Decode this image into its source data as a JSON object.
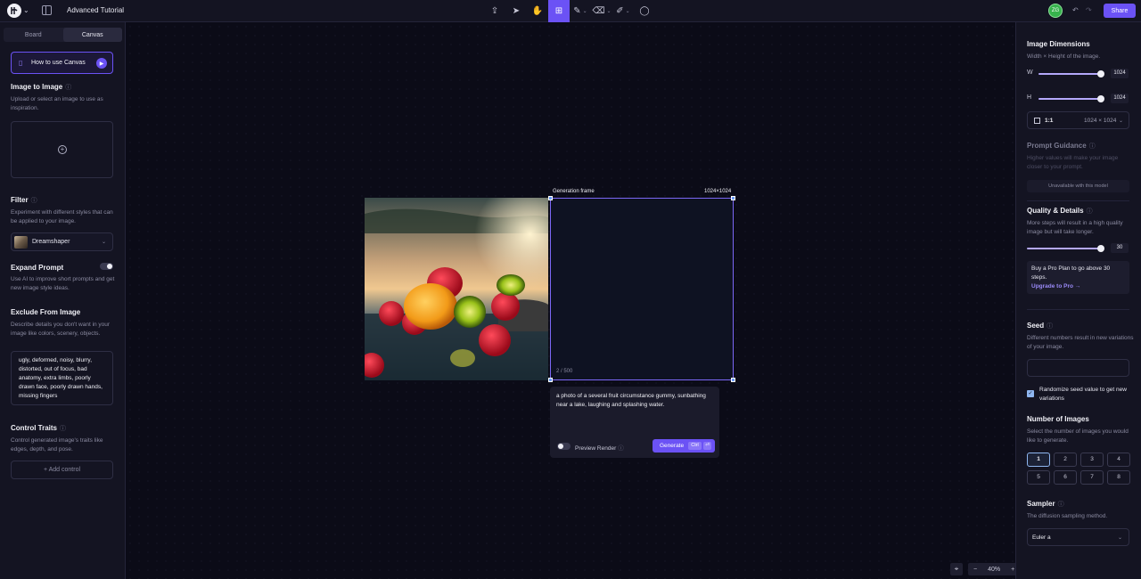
{
  "header": {
    "project_title": "Advanced Tutorial",
    "avatar_initials": "ZG",
    "share_label": "Share",
    "tools": [
      "export-icon",
      "select-icon",
      "hand-icon",
      "generate-frame-icon",
      "brush-icon",
      "eraser-icon",
      "pen-icon",
      "comment-icon"
    ],
    "active_tool": "generate-frame-icon"
  },
  "left": {
    "tabs": [
      "Board",
      "Canvas"
    ],
    "active_tab": "Canvas",
    "howto_label": "How to use Canvas",
    "img2img": {
      "title": "Image to Image",
      "desc": "Upload or select an image to use as inspiration."
    },
    "filter": {
      "title": "Filter",
      "desc": "Experiment with different styles that can be applied to your image.",
      "selected": "Dreamshaper"
    },
    "expand": {
      "title": "Expand Prompt",
      "desc": "Use AI to improve short prompts and get new image style ideas."
    },
    "exclude": {
      "title": "Exclude From Image",
      "desc": "Describe details you don't want in your image like colors, scenery, objects.",
      "value": "ugly, deformed, noisy, blurry, distorted, out of focus, bad anatomy, extra limbs, poorly drawn face, poorly drawn hands, missing fingers"
    },
    "control": {
      "title": "Control Traits",
      "desc": "Control generated image's traits like edges, depth, and pose.",
      "add_label": "+ Add control"
    }
  },
  "canvas": {
    "frame_label": "Generation frame",
    "frame_size": "1024×1024",
    "counter": "2 / 500",
    "prompt_text": "a photo of a several fruit circumstance gummy, sunbathing near a lake, laughing and splashing water.",
    "preview_label": "Preview Render",
    "generate_label": "Generate",
    "kbd_label": "Ctrl",
    "zoom": "40%",
    "zoom_minus": "−",
    "zoom_plus": "+"
  },
  "right": {
    "dims": {
      "title": "Image Dimensions",
      "desc": "Width × Height of the image.",
      "w_label": "W",
      "h_label": "H",
      "w_value": "1024",
      "h_value": "1024",
      "ratio": "1:1",
      "ratio_dims": "1024  ×  1024"
    },
    "guidance": {
      "title": "Prompt Guidance",
      "desc": "Higher values will make your image closer to your prompt.",
      "unavailable": "Unavailable with this model"
    },
    "quality": {
      "title": "Quality & Details",
      "desc": "More steps will result in a high quality image but will take longer.",
      "value": "30",
      "pro_text": "Buy a Pro Plan to go above 30 steps.",
      "upgrade": "Upgrade to Pro →"
    },
    "seed": {
      "title": "Seed",
      "desc": "Different numbers result in new variations of your image.",
      "randomize": "Randomize seed value to get new variations"
    },
    "num_images": {
      "title": "Number of Images",
      "desc": "Select the number of images you would like to generate.",
      "options": [
        "1",
        "2",
        "3",
        "4",
        "5",
        "6",
        "7",
        "8"
      ],
      "selected": "1"
    },
    "sampler": {
      "title": "Sampler",
      "desc": "The diffusion sampling method.",
      "value": "Euler a"
    }
  },
  "colors": {
    "accent": "#6b52f5",
    "frame": "#7b68f6",
    "handle": "#6b9bf5",
    "bg": "#0b0b17"
  }
}
